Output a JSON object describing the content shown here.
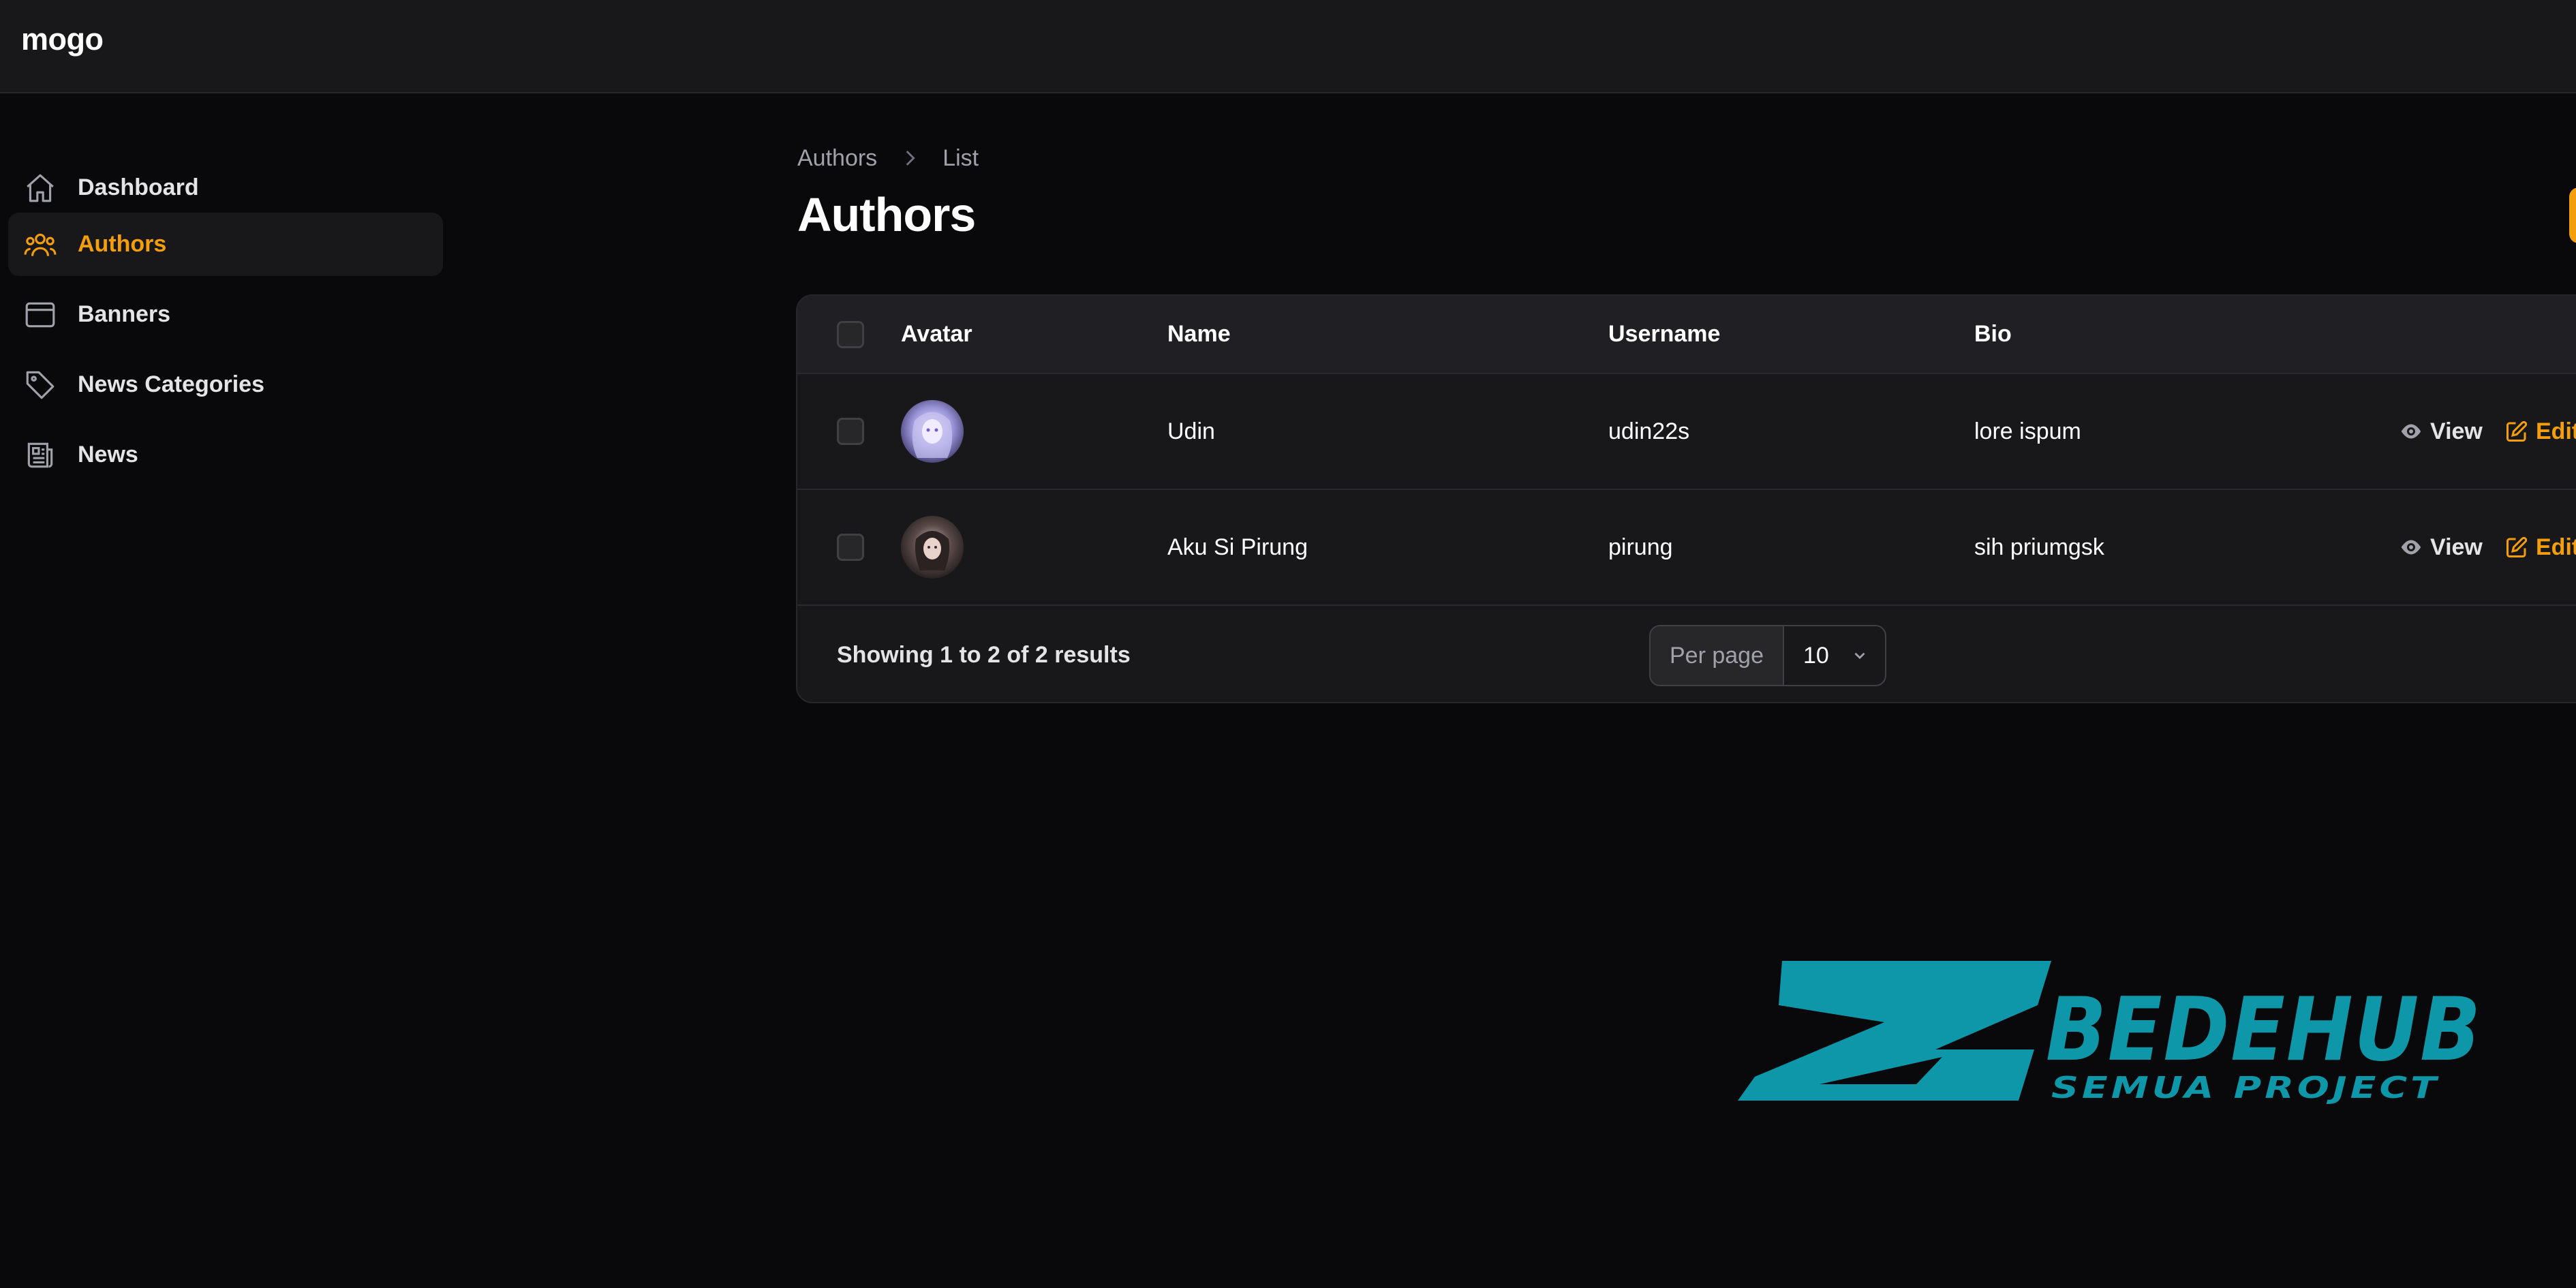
{
  "app": {
    "brand": "mogo"
  },
  "sidebar": {
    "items": [
      {
        "label": "Dashboard",
        "icon": "home-icon",
        "active": false
      },
      {
        "label": "Authors",
        "icon": "users-icon",
        "active": true
      },
      {
        "label": "Banners",
        "icon": "browser-window-icon",
        "active": false
      },
      {
        "label": "News Categories",
        "icon": "tag-icon",
        "active": false
      },
      {
        "label": "News",
        "icon": "newspaper-icon",
        "active": false
      }
    ]
  },
  "breadcrumb": {
    "items": [
      "Authors",
      "List"
    ]
  },
  "page": {
    "title": "Authors"
  },
  "table": {
    "columns": [
      "Avatar",
      "Name",
      "Username",
      "Bio"
    ],
    "rows": [
      {
        "name": "Udin",
        "username": "udin22s",
        "bio": "lore ispum",
        "view": "View",
        "edit": "Edit"
      },
      {
        "name": "Aku Si Pirung",
        "username": "pirung",
        "bio": "sih priumgsk",
        "view": "View",
        "edit": "Edit"
      }
    ],
    "footer": {
      "results": "Showing 1 to 2 of 2 results",
      "per_page_label": "Per page",
      "per_page_value": "10"
    }
  },
  "watermark": {
    "title": "BEDEHUB",
    "subtitle": "SEMUA PROJECT"
  },
  "colors": {
    "accent": "#f59e0b",
    "watermark": "#0e97a8",
    "background": "#09090b",
    "surface": "#18181b"
  }
}
